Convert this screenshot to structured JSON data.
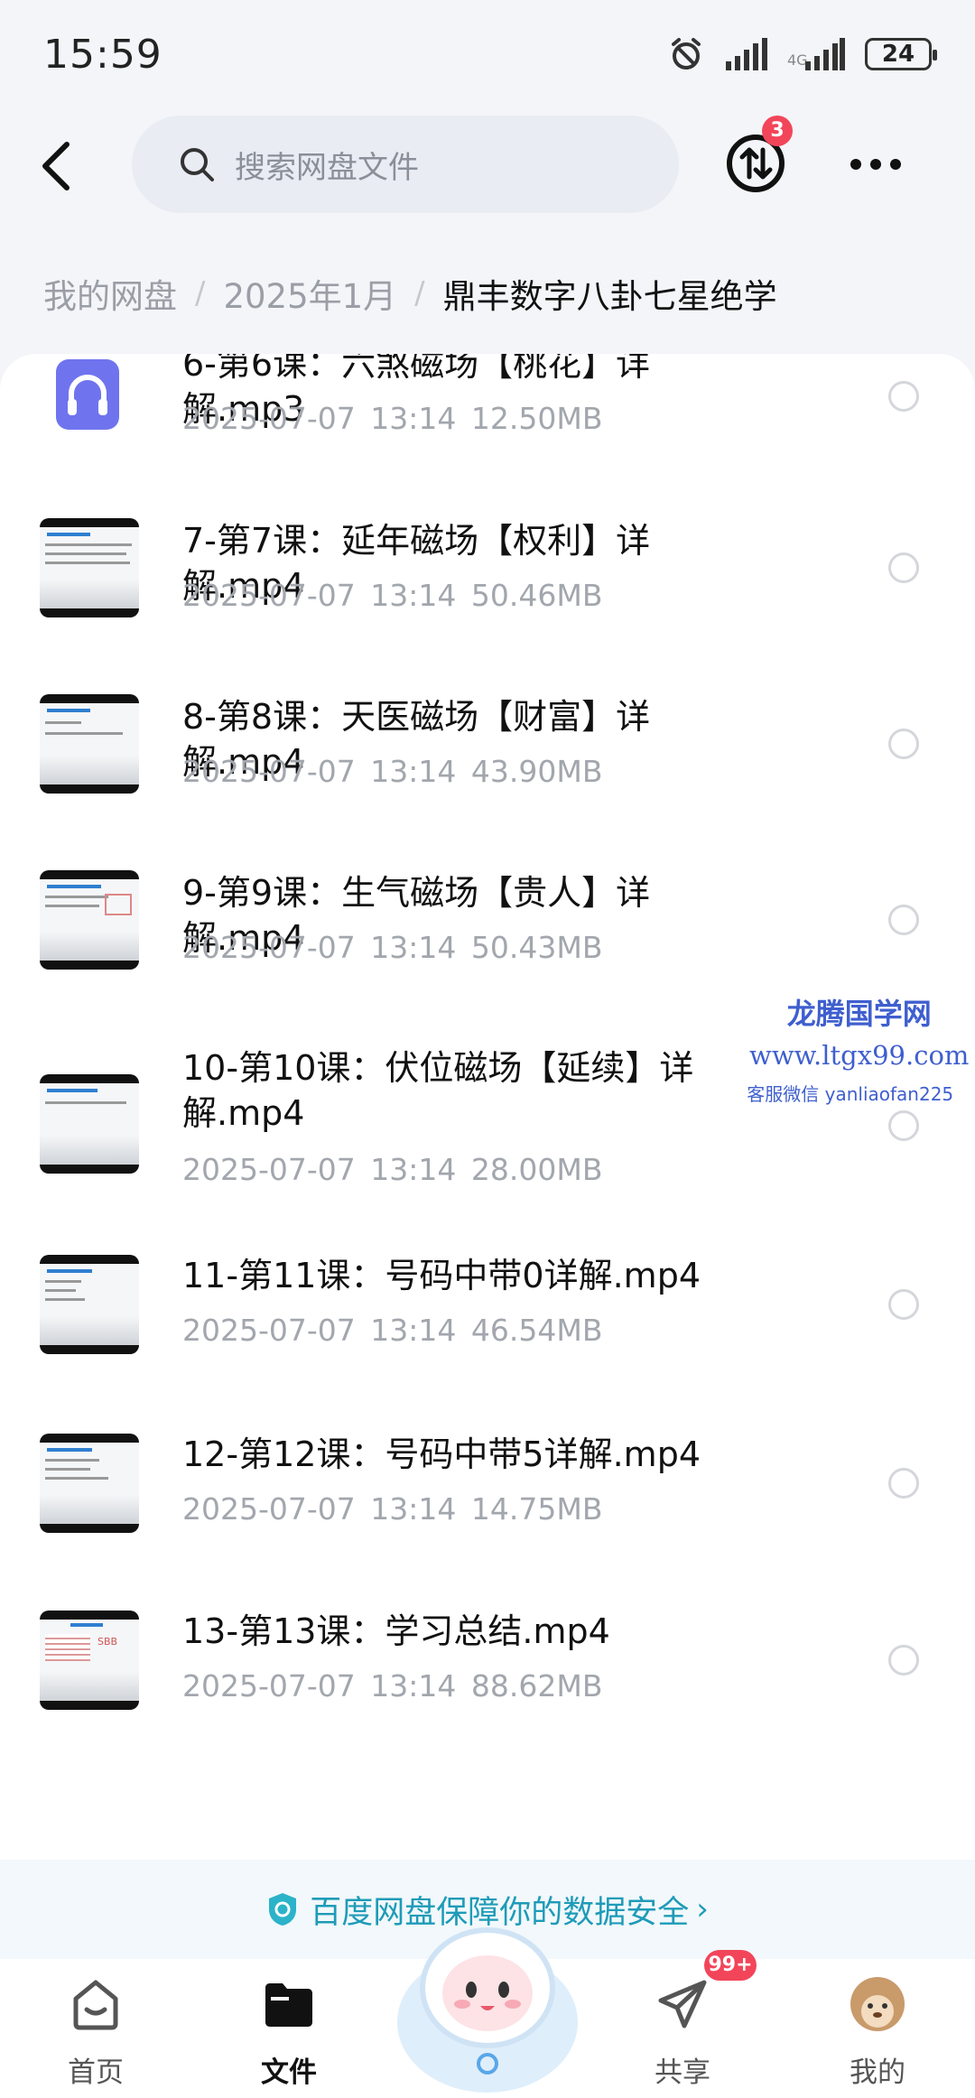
{
  "status_bar": {
    "time": "15:59",
    "battery": "24"
  },
  "search": {
    "placeholder": "搜索网盘文件"
  },
  "transfer": {
    "badge": "3"
  },
  "breadcrumb": {
    "items": [
      "我的网盘",
      "2025年1月"
    ],
    "current": "鼎丰数字八卦七星绝学"
  },
  "files": [
    {
      "name": "6-第6课：六煞磁场【桃花】详解.mp3",
      "date": "2025-07-07",
      "time": "13:14",
      "size": "12.50MB",
      "kind": "audio"
    },
    {
      "name": "7-第7课：延年磁场【权利】详解.mp4",
      "date": "2025-07-07",
      "time": "13:14",
      "size": "50.46MB",
      "kind": "video"
    },
    {
      "name": "8-第8课：天医磁场【财富】详解.mp4",
      "date": "2025-07-07",
      "time": "13:14",
      "size": "43.90MB",
      "kind": "video"
    },
    {
      "name": "9-第9课：生气磁场【贵人】详解.mp4",
      "date": "2025-07-07",
      "time": "13:14",
      "size": "50.43MB",
      "kind": "video"
    },
    {
      "name": "10-第10课：伏位磁场【延续】详解.mp4",
      "date": "2025-07-07",
      "time": "13:14",
      "size": "28.00MB",
      "kind": "video"
    },
    {
      "name": "11-第11课：号码中带0详解.mp4",
      "date": "2025-07-07",
      "time": "13:14",
      "size": "46.54MB",
      "kind": "video"
    },
    {
      "name": "12-第12课：号码中带5详解.mp4",
      "date": "2025-07-07",
      "time": "13:14",
      "size": "14.75MB",
      "kind": "video"
    },
    {
      "name": "13-第13课：学习总结.mp4",
      "date": "2025-07-07",
      "time": "13:14",
      "size": "88.62MB",
      "kind": "video"
    }
  ],
  "watermark": {
    "title": "龙腾国学网",
    "url": "www.ltgx99.com",
    "contact": "客服微信 yanliaofan225"
  },
  "security_banner": {
    "text": "百度网盘保障你的数据安全"
  },
  "bottom_nav": {
    "items": [
      {
        "label": "首页",
        "icon": "home-icon"
      },
      {
        "label": "文件",
        "icon": "folder-icon",
        "active": true
      },
      {
        "label": "共享",
        "icon": "send-icon",
        "badge": "99+"
      },
      {
        "label": "我的",
        "icon": "avatar"
      }
    ]
  },
  "colors": {
    "accent": "#1e9bb8",
    "badge": "#f2455a",
    "watermark": "#3f5fcf"
  }
}
